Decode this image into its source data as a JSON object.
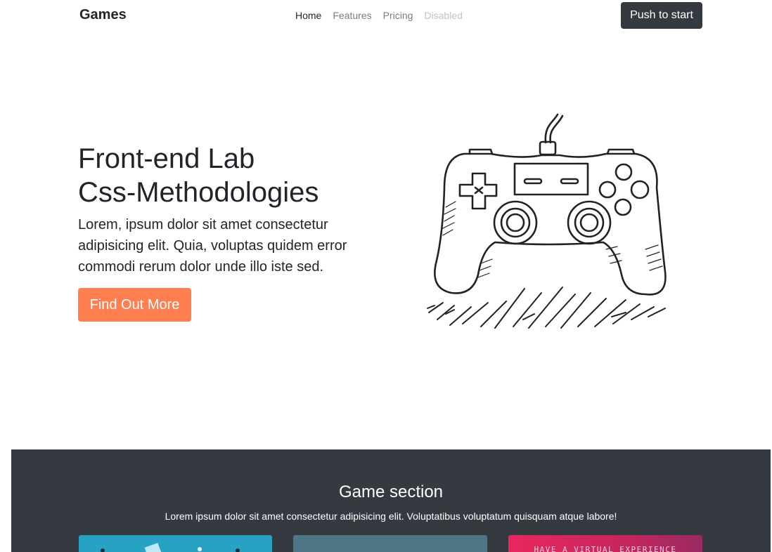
{
  "navbar": {
    "brand": "Games",
    "links": [
      {
        "label": "Home",
        "state": "active"
      },
      {
        "label": "Features",
        "state": "normal"
      },
      {
        "label": "Pricing",
        "state": "normal"
      },
      {
        "label": "Disabled",
        "state": "disabled"
      }
    ],
    "cta_label": "Push to start"
  },
  "hero": {
    "title_line1": "Front-end Lab",
    "title_line2": "Css-Methodologies",
    "text": "Lorem, ipsum dolor sit amet consectetur adipisicing elit. Quia, voluptas quidem error commodi rerum dolor unde illo iste sed.",
    "button_label": "Find Out More",
    "image_icon": "gamepad-sketch-icon",
    "accent_color": "#ff7f50"
  },
  "game_section": {
    "title": "Game section",
    "text": "Lorem ipsum dolor sit amet consectetur adipisicing elit. Voluptatibus voluptatum quisquam atque labore!",
    "background_color": "#343a40",
    "cards": [
      {
        "caption": "",
        "color": "#26a3c3"
      },
      {
        "caption": "",
        "color": "#4d7686"
      },
      {
        "caption": "HAVE A VIRTUAL EXPERIENCE",
        "color": "#e8285e"
      }
    ]
  }
}
